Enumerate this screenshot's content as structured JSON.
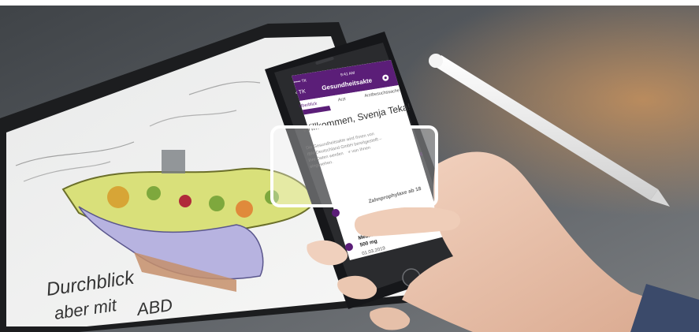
{
  "phone": {
    "status": {
      "carrier": "••••• TK",
      "time": "9:41 AM"
    },
    "nav": {
      "back": "‹ TK",
      "title": "Gesundheitsakte",
      "gear_icon": "gear-icon"
    },
    "tabs": [
      {
        "label": "Überblick",
        "active": true
      },
      {
        "label": "Arzt",
        "active": false
      },
      {
        "label": "Arztbesuchssache",
        "active": false
      }
    ],
    "welcome": "Willkommen, Svenja Teka!",
    "intro": [
      "Die Gesundheitsakte wird Ihnen von",
      "IBM Deutschland GmbH bereitgestellt –",
      "ihre Daten werden nur von Ihnen",
      "eingesehen."
    ],
    "counter": "6",
    "timeline": [
      {
        "icon": "tooth-icon",
        "title": "Zahnprophylaxe ab 18"
      },
      {
        "icon": "pill-icon",
        "title": "Medikation",
        "detail": "500 mg",
        "date": "01.03.2019"
      }
    ]
  },
  "sketch": {
    "handwriting": [
      "Durchblick",
      "aber mit",
      "ABD"
    ]
  },
  "video_overlay": {
    "icon": "play-icon",
    "state": "paused"
  },
  "colors": {
    "app_purple": "#5b1e78",
    "overlay_fill": "#ffffff",
    "background": "#565a5f"
  }
}
